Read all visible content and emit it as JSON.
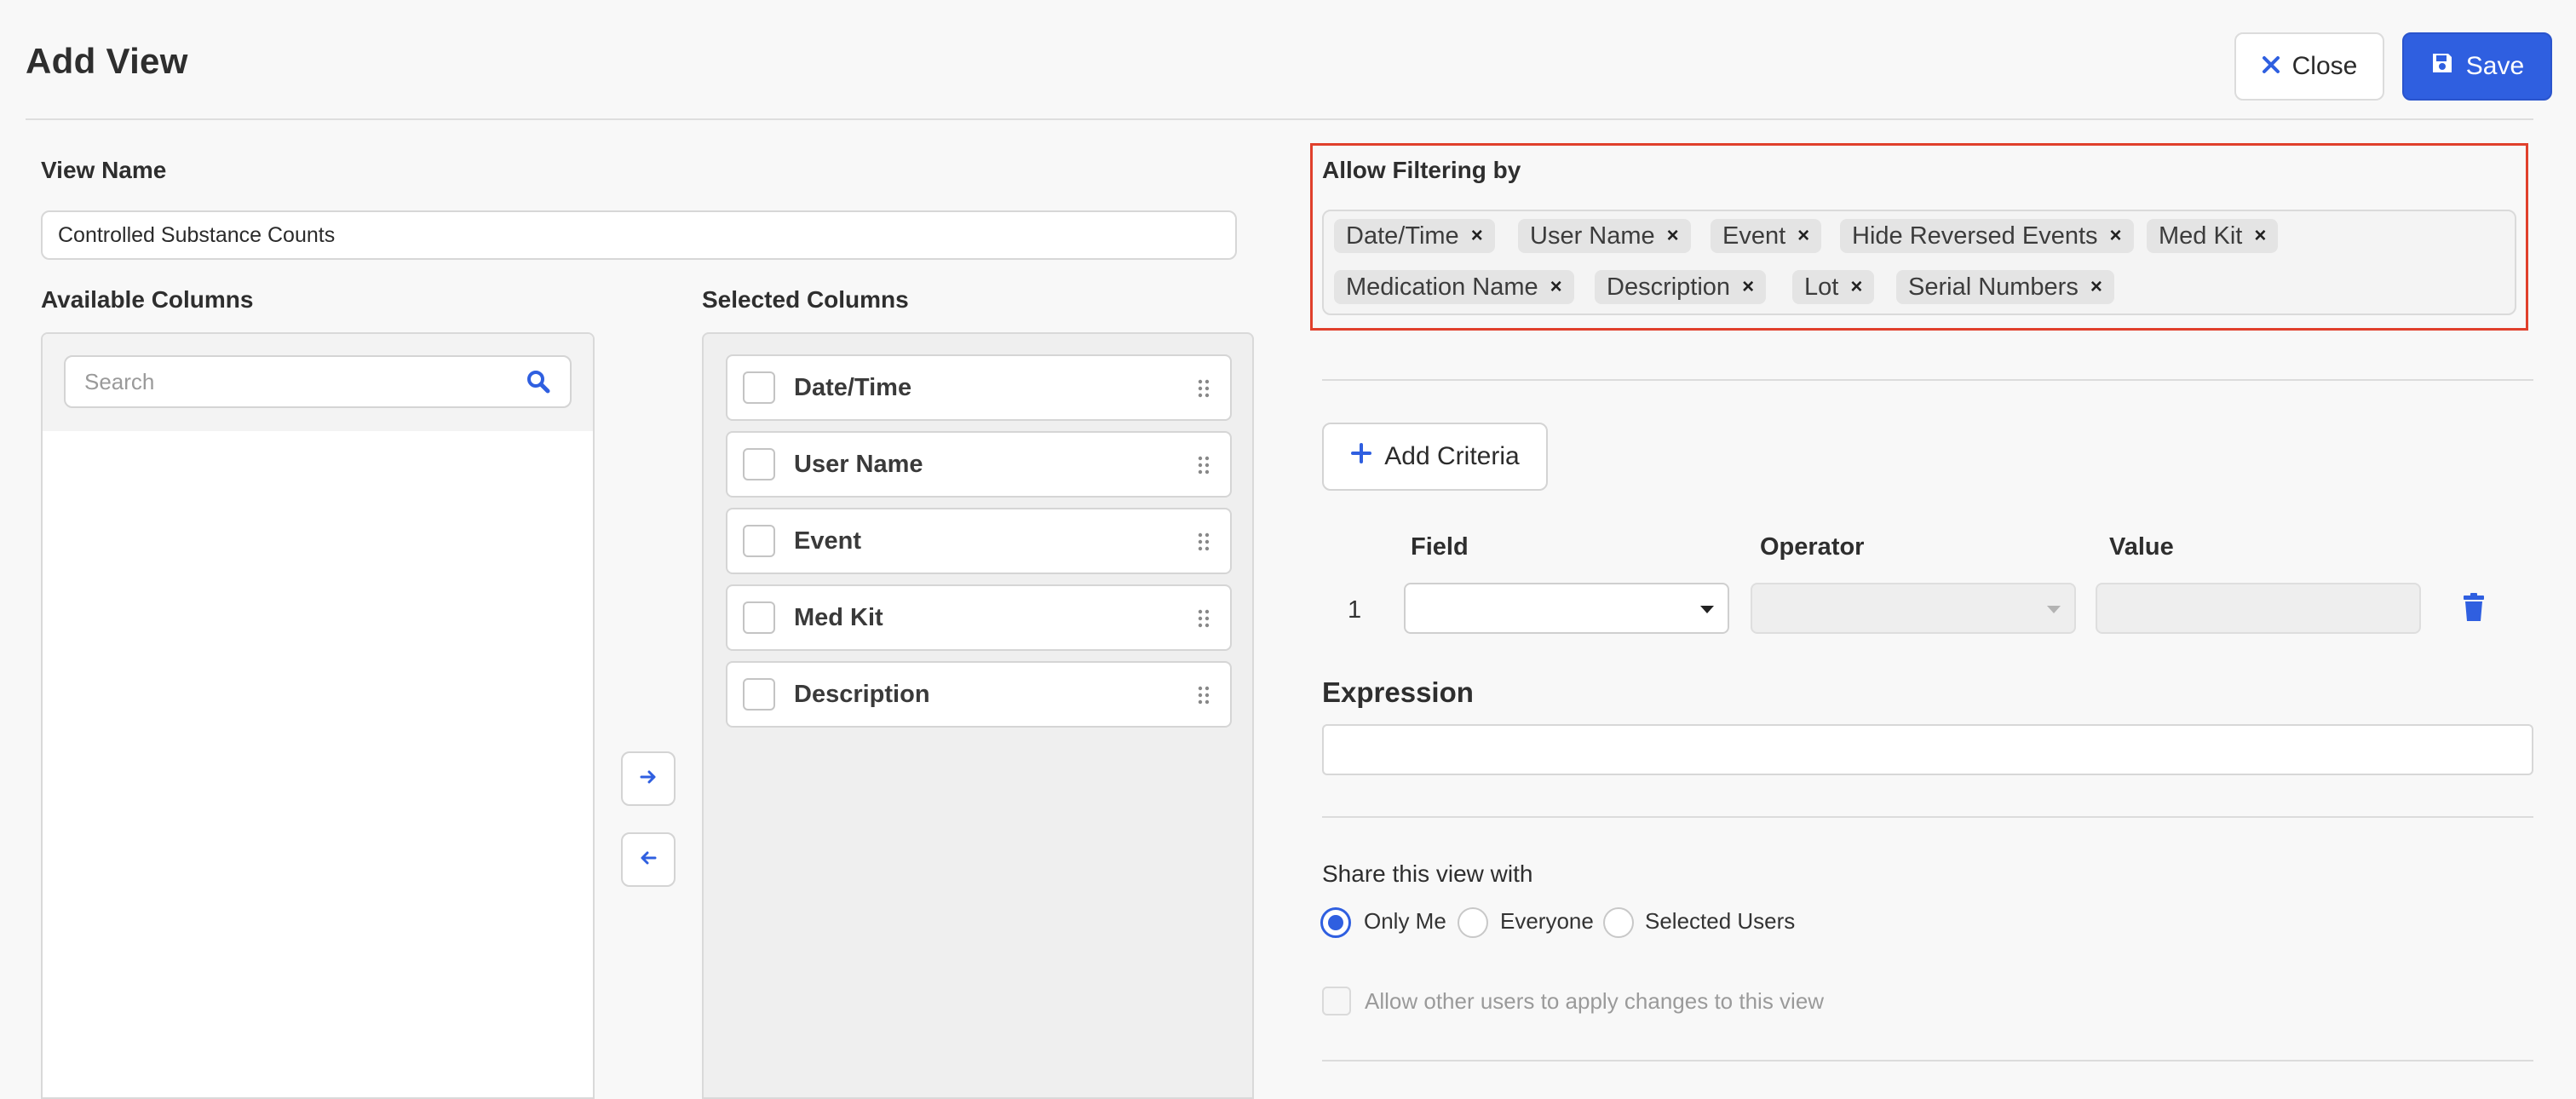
{
  "header": {
    "title": "Add View",
    "close_label": "Close",
    "save_label": "Save"
  },
  "view_name": {
    "label": "View Name",
    "value": "Controlled Substance Counts"
  },
  "available_columns": {
    "label": "Available Columns",
    "search_placeholder": "Search",
    "items": []
  },
  "selected_columns": {
    "label": "Selected Columns",
    "items": [
      {
        "label": "Date/Time"
      },
      {
        "label": "User Name"
      },
      {
        "label": "Event"
      },
      {
        "label": "Med Kit"
      },
      {
        "label": "Description"
      }
    ]
  },
  "filtering": {
    "label": "Allow Filtering by",
    "chips": [
      {
        "label": "Date/Time"
      },
      {
        "label": "User Name"
      },
      {
        "label": "Event"
      },
      {
        "label": "Hide Reversed Events"
      },
      {
        "label": "Med Kit"
      },
      {
        "label": "Medication Name"
      },
      {
        "label": "Description"
      },
      {
        "label": "Lot"
      },
      {
        "label": "Serial Numbers"
      }
    ],
    "remove_glyph": "×"
  },
  "criteria": {
    "add_label": "Add Criteria",
    "columns": {
      "field": "Field",
      "operator": "Operator",
      "value": "Value"
    },
    "rows": [
      {
        "number": "1",
        "field": "",
        "operator": "",
        "value": ""
      }
    ]
  },
  "expression": {
    "label": "Expression",
    "value": ""
  },
  "share": {
    "label": "Share this view with",
    "options": [
      {
        "label": "Only Me",
        "checked": true
      },
      {
        "label": "Everyone",
        "checked": false
      },
      {
        "label": "Selected Users",
        "checked": false
      }
    ],
    "allow_changes_label": "Allow other users to apply changes to this view",
    "allow_changes_checked": false
  },
  "colors": {
    "accent": "#2f5fe0",
    "highlight_border": "#e0402c"
  }
}
